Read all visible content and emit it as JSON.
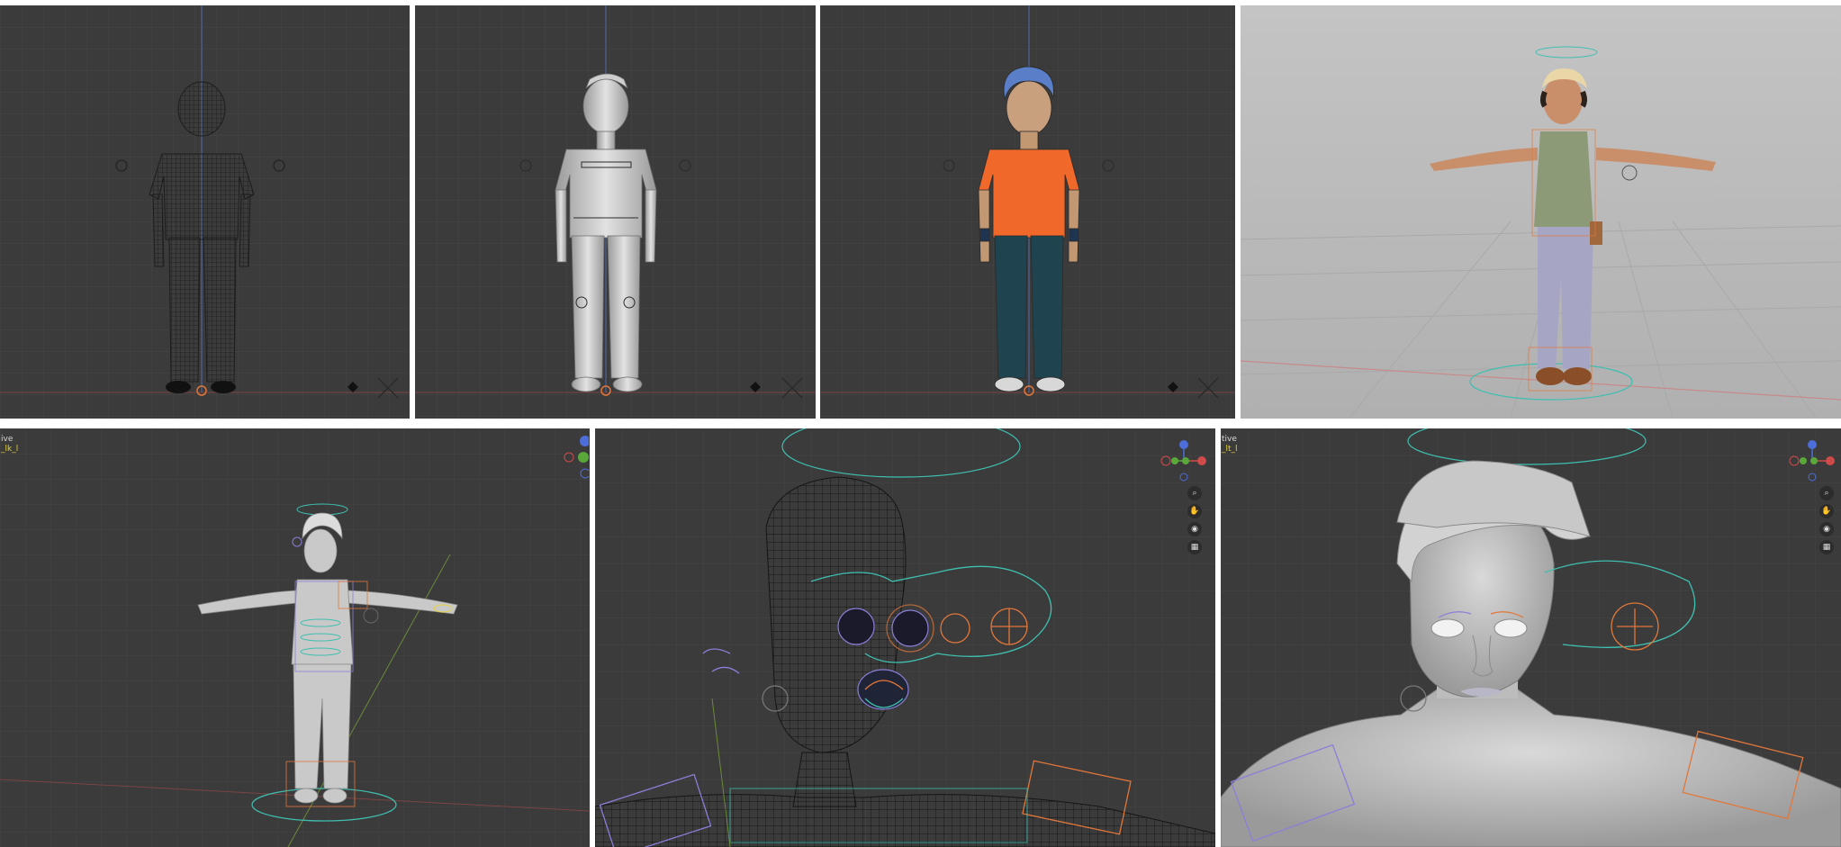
{
  "panels": [
    {
      "name": "viewport-wireframe-front",
      "shading": "wireframe"
    },
    {
      "name": "viewport-solid-front",
      "shading": "solid"
    },
    {
      "name": "viewport-material-front",
      "shading": "material-preview"
    },
    {
      "name": "viewport-rendered-perspective",
      "shading": "rendered"
    },
    {
      "name": "viewport-rig-full-body",
      "shading": "solid"
    },
    {
      "name": "viewport-rig-head-wireframe",
      "shading": "wireframe"
    },
    {
      "name": "viewport-head-closeup",
      "shading": "solid"
    }
  ],
  "overlays": {
    "panel5_mode": "ive",
    "panel5_object": "_lk_l",
    "panel7_mode": "tive",
    "panel7_object": "_lt_l"
  },
  "gizmo": {
    "axis_x": "X",
    "axis_y": "Y",
    "axis_z": "Z"
  },
  "tools": {
    "zoom_icon": "magnifier-icon",
    "pan_icon": "hand-icon",
    "camera_icon": "camera-icon",
    "grid_icon": "grid-icon"
  },
  "colors": {
    "viewport_dark": "#3b3b3b",
    "viewport_grey": "#b8b8b8",
    "rig_teal": "#3fbfb0",
    "rig_orange": "#e2773a",
    "rig_purple": "#8a7fd8",
    "shirt_orange": "#f0692a",
    "pants_teal": "#1f4450",
    "hair_blue": "#5a7fc8",
    "tanktop_green": "#8d9a78",
    "pants_lavender": "#a7a5c4"
  }
}
